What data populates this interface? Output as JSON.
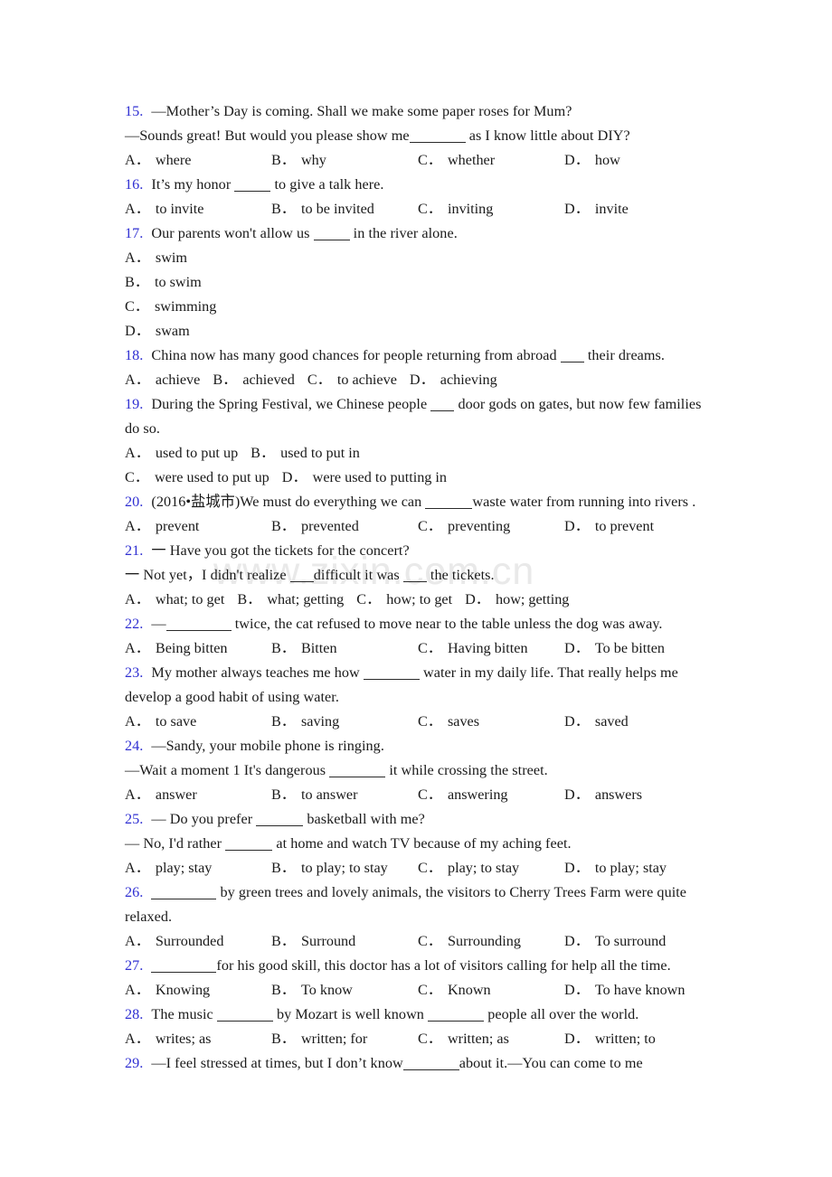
{
  "document": {
    "watermark": "www.zixin.com.cn",
    "number_color": "#2f2fd2",
    "text_color": "#1a1a1a"
  },
  "questions": [
    {
      "number": "15.",
      "lines": [
        "—Mother’s Day is coming. Shall we make some paper roses for Mum?",
        "—Sounds great! But would you please show me"
      ],
      "line2_tail": "as I know little about DIY?",
      "options": [
        {
          "letter": "A．",
          "text": "where"
        },
        {
          "letter": "B．",
          "text": "why"
        },
        {
          "letter": "C．",
          "text": "whether"
        },
        {
          "letter": "D．",
          "text": "how"
        }
      ]
    },
    {
      "number": "16.",
      "stem_head": "It’s my honor",
      "stem_tail": "to give a talk here.",
      "options": [
        {
          "letter": "A．",
          "text": "to invite"
        },
        {
          "letter": "B．",
          "text": "to be invited"
        },
        {
          "letter": "C．",
          "text": "inviting"
        },
        {
          "letter": "D．",
          "text": "invite"
        }
      ]
    },
    {
      "number": "17.",
      "stem_head": "Our parents won't allow us",
      "stem_tail": "in the river alone.",
      "options": [
        {
          "letter": "A．",
          "text": "swim"
        },
        {
          "letter": "B．",
          "text": "to swim"
        },
        {
          "letter": "C．",
          "text": "swimming"
        },
        {
          "letter": "D．",
          "text": "swam"
        }
      ]
    },
    {
      "number": "18.",
      "stem_head": "China now has many good chances for people returning from abroad",
      "stem_tail": "their dreams.",
      "options": [
        {
          "letter": "A．",
          "text": "achieve"
        },
        {
          "letter": "B．",
          "text": "achieved"
        },
        {
          "letter": "C．",
          "text": "to achieve"
        },
        {
          "letter": "D．",
          "text": "achieving"
        }
      ]
    },
    {
      "number": "19.",
      "stem_head": "During the Spring Festival, we Chinese people",
      "stem_tail": "door gods on gates, but now few families do so.",
      "options": [
        {
          "letter": "A．",
          "text": "used to put up"
        },
        {
          "letter": "B．",
          "text": "used to put in"
        },
        {
          "letter": "C．",
          "text": "were used to put up"
        },
        {
          "letter": "D．",
          "text": "were used to putting in"
        }
      ]
    },
    {
      "number": "20.",
      "stem_head": "(2016•盐城市)We must do everything we can",
      "stem_tail": "waste water from running into rivers .",
      "options": [
        {
          "letter": "A．",
          "text": "prevent"
        },
        {
          "letter": "B．",
          "text": "prevented"
        },
        {
          "letter": "C．",
          "text": "preventing"
        },
        {
          "letter": "D．",
          "text": "to prevent"
        }
      ]
    },
    {
      "number": "21.",
      "lines": [
        "一 Have you got the tickets for the concert?"
      ],
      "line2_head": "一 Not yet，I didn't realize",
      "line2_mid": "difficult it was",
      "line2_tail": "the tickets.",
      "options": [
        {
          "letter": "A．",
          "text": "what; to get"
        },
        {
          "letter": "B．",
          "text": "what; getting"
        },
        {
          "letter": "C．",
          "text": "how; to get"
        },
        {
          "letter": "D．",
          "text": "how; getting"
        }
      ]
    },
    {
      "number": "22.",
      "stem_head": "—",
      "stem_tail": "twice, the cat refused to move near to the table unless the dog was away.",
      "options": [
        {
          "letter": "A．",
          "text": "Being bitten"
        },
        {
          "letter": "B．",
          "text": "Bitten"
        },
        {
          "letter": "C．",
          "text": "Having bitten"
        },
        {
          "letter": "D．",
          "text": "To be bitten"
        }
      ]
    },
    {
      "number": "23.",
      "stem_head": "My mother always teaches me how",
      "stem_tail": "water in my daily life. That really helps me develop a good habit of using water.",
      "options": [
        {
          "letter": "A．",
          "text": "to save"
        },
        {
          "letter": "B．",
          "text": "saving"
        },
        {
          "letter": "C．",
          "text": "saves"
        },
        {
          "letter": "D．",
          "text": "saved"
        }
      ]
    },
    {
      "number": "24.",
      "lines": [
        "—Sandy, your mobile phone is ringing."
      ],
      "line2_head": "—Wait a moment 1 It's dangerous",
      "line2_tail": "it while crossing the street.",
      "options": [
        {
          "letter": "A．",
          "text": "answer"
        },
        {
          "letter": "B．",
          "text": "to answer"
        },
        {
          "letter": "C．",
          "text": "answering"
        },
        {
          "letter": "D．",
          "text": "answers"
        }
      ]
    },
    {
      "number": "25.",
      "line1_head": "— Do you prefer",
      "line1_tail": "basketball with me?",
      "line2_head": "— No, I'd rather",
      "line2_tail": "at home and watch TV because of my aching feet.",
      "options": [
        {
          "letter": "A．",
          "text": "play; stay"
        },
        {
          "letter": "B．",
          "text": "to play; to stay"
        },
        {
          "letter": "C．",
          "text": "play; to stay"
        },
        {
          "letter": "D．",
          "text": "to play; stay"
        }
      ]
    },
    {
      "number": "26.",
      "stem_head": "",
      "stem_tail": "by green trees and lovely animals, the visitors to Cherry Trees Farm were quite relaxed.",
      "options": [
        {
          "letter": "A．",
          "text": "Surrounded"
        },
        {
          "letter": "B．",
          "text": "Surround"
        },
        {
          "letter": "C．",
          "text": "Surrounding"
        },
        {
          "letter": "D．",
          "text": "To surround"
        }
      ]
    },
    {
      "number": "27.",
      "stem_head": "",
      "stem_tail": "for his good skill, this doctor has a lot of visitors calling for help all the time.",
      "options": [
        {
          "letter": "A．",
          "text": "Knowing"
        },
        {
          "letter": "B．",
          "text": "To know"
        },
        {
          "letter": "C．",
          "text": "Known"
        },
        {
          "letter": "D．",
          "text": "To have known"
        }
      ]
    },
    {
      "number": "28.",
      "stem_head": "The music",
      "stem_mid": "by Mozart is well known",
      "stem_tail": "people all over the world.",
      "options": [
        {
          "letter": "A．",
          "text": "writes; as"
        },
        {
          "letter": "B．",
          "text": "written; for"
        },
        {
          "letter": "C．",
          "text": "written; as"
        },
        {
          "letter": "D．",
          "text": "written; to"
        }
      ]
    },
    {
      "number": "29.",
      "stem_head": "—I feel stressed at times, but I don’t know",
      "stem_tail": "about it.—You can come to me"
    }
  ]
}
